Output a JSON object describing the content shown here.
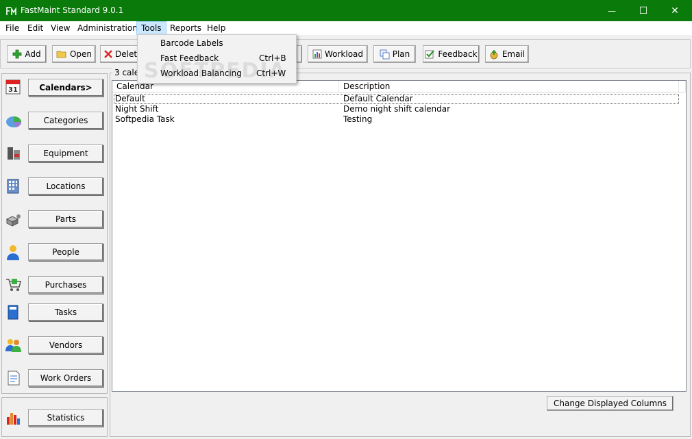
{
  "window": {
    "title": "FastMaint Standard 9.0.1",
    "minimize": "—",
    "maximize": "☐",
    "close": "✕"
  },
  "menu": [
    "File",
    "Edit",
    "View",
    "Administration",
    "Tools",
    "Reports",
    "Help"
  ],
  "tools_menu": {
    "items": [
      {
        "label": "Barcode Labels",
        "shortcut": ""
      },
      {
        "label": "Fast Feedback",
        "shortcut": "Ctrl+B"
      },
      {
        "label": "Workload Balancing",
        "shortcut": "Ctrl+W"
      }
    ]
  },
  "toolbar": {
    "add": "Add",
    "open": "Open",
    "delete": "Delete",
    "workload": "Workload",
    "plan": "Plan",
    "feedback": "Feedback",
    "email": "Email"
  },
  "sidebar": {
    "items": [
      "Calendars>",
      "Categories",
      "Equipment",
      "Locations",
      "Parts",
      "People",
      "Purchases",
      "Tasks",
      "Vendors",
      "Work Orders"
    ],
    "statistics": "Statistics"
  },
  "main": {
    "count_label": "3 cale",
    "columns": [
      "Calendar",
      "Description"
    ],
    "rows": [
      {
        "calendar": "Default",
        "description": "Default Calendar"
      },
      {
        "calendar": "Night Shift",
        "description": "Demo night shift calendar"
      },
      {
        "calendar": "Softpedia Task",
        "description": "Testing"
      }
    ],
    "change_columns": "Change Displayed Columns"
  },
  "watermark": "SOFTPEDIA",
  "colors": {
    "titlebar": "#0a7a0a",
    "menu_highlight": "#cce8ff"
  }
}
